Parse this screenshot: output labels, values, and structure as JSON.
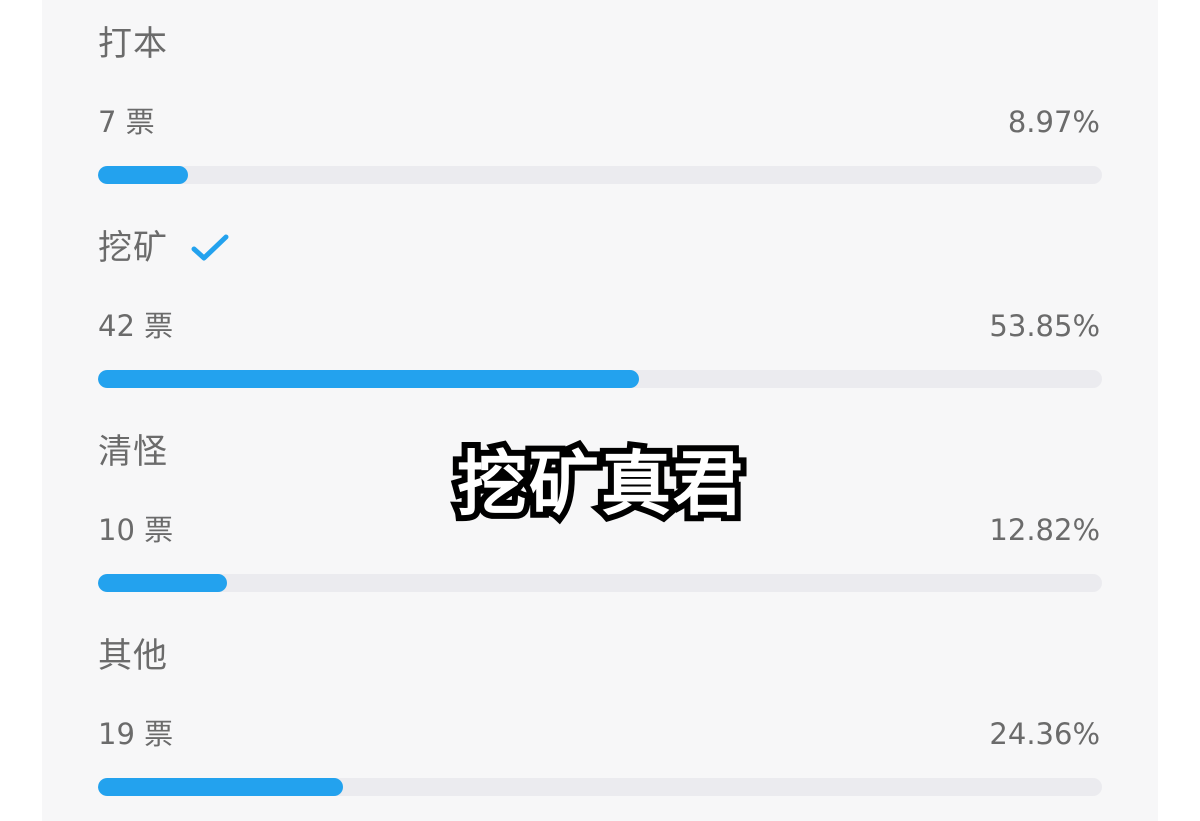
{
  "poll": {
    "options": [
      {
        "label": "打本",
        "votes": "7 票",
        "percent": "8.97%",
        "fraction": 0.0897,
        "selected": false
      },
      {
        "label": "挖矿",
        "votes": "42 票",
        "percent": "53.85%",
        "fraction": 0.5385,
        "selected": true
      },
      {
        "label": "清怪",
        "votes": "10 票",
        "percent": "12.82%",
        "fraction": 0.1282,
        "selected": false
      },
      {
        "label": "其他",
        "votes": "19 票",
        "percent": "24.36%",
        "fraction": 0.2436,
        "selected": false
      }
    ]
  },
  "overlay": {
    "caption": "挖矿真君"
  },
  "colors": {
    "accent": "#23a2ee",
    "track": "#ebebef",
    "panel": "#f7f7f8",
    "text": "#6b6b6b"
  },
  "icons": {
    "selected_marker": "check-icon"
  }
}
